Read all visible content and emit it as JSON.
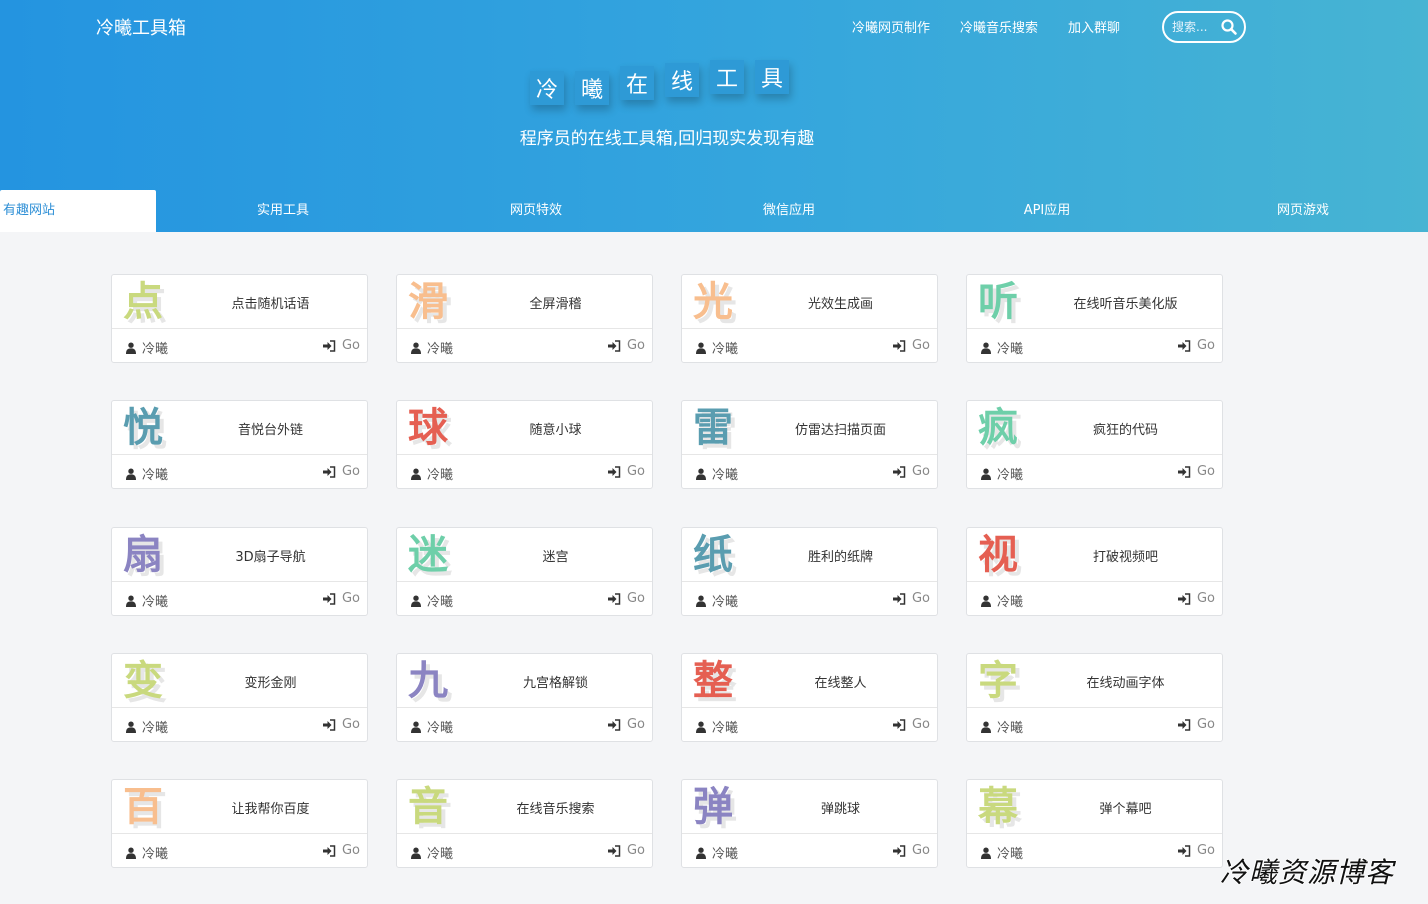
{
  "brand": "冷曦工具箱",
  "topnav": [
    {
      "label": "冷曦网页制作"
    },
    {
      "label": "冷曦音乐搜索"
    },
    {
      "label": "加入群聊"
    }
  ],
  "search": {
    "placeholder": "搜索..."
  },
  "logo_chars": [
    "冷",
    "曦",
    "在",
    "线",
    "工",
    "具"
  ],
  "subtitle": "程序员的在线工具箱,回归现实发现有趣",
  "tabs": [
    {
      "label": "有趣网站",
      "active": true
    },
    {
      "label": "实用工具"
    },
    {
      "label": "网页特效"
    },
    {
      "label": "微信应用"
    },
    {
      "label": "API应用"
    },
    {
      "label": "网页游戏"
    }
  ],
  "cards": [
    {
      "char": "点",
      "title": "点击随机话语",
      "author": "冷曦",
      "go": "Go",
      "color": "#c9d97e"
    },
    {
      "char": "滑",
      "title": "全屏滑稽",
      "author": "冷曦",
      "go": "Go",
      "color": "#f8be8e"
    },
    {
      "char": "光",
      "title": "光效生成画",
      "author": "冷曦",
      "go": "Go",
      "color": "#f8be8e"
    },
    {
      "char": "听",
      "title": "在线听音乐美化版",
      "author": "冷曦",
      "go": "Go",
      "color": "#6ecfa9"
    },
    {
      "char": "悦",
      "title": "音悦台外链",
      "author": "冷曦",
      "go": "Go",
      "color": "#5a9db0"
    },
    {
      "char": "球",
      "title": "随意小球",
      "author": "冷曦",
      "go": "Go",
      "color": "#e55f52"
    },
    {
      "char": "雷",
      "title": "仿雷达扫描页面",
      "author": "冷曦",
      "go": "Go",
      "color": "#5a9db0"
    },
    {
      "char": "疯",
      "title": "疯狂的代码",
      "author": "冷曦",
      "go": "Go",
      "color": "#6ecfa9"
    },
    {
      "char": "扇",
      "title": "3D扇子导航",
      "author": "冷曦",
      "go": "Go",
      "color": "#8b84c2"
    },
    {
      "char": "迷",
      "title": "迷宫",
      "author": "冷曦",
      "go": "Go",
      "color": "#6ecfa9"
    },
    {
      "char": "纸",
      "title": "胜利的纸牌",
      "author": "冷曦",
      "go": "Go",
      "color": "#5a9db0"
    },
    {
      "char": "视",
      "title": "打破视频吧",
      "author": "冷曦",
      "go": "Go",
      "color": "#e55f52"
    },
    {
      "char": "变",
      "title": "变形金刚",
      "author": "冷曦",
      "go": "Go",
      "color": "#c9d97e"
    },
    {
      "char": "九",
      "title": "九宫格解锁",
      "author": "冷曦",
      "go": "Go",
      "color": "#8b84c2"
    },
    {
      "char": "整",
      "title": "在线整人",
      "author": "冷曦",
      "go": "Go",
      "color": "#e55f52"
    },
    {
      "char": "字",
      "title": "在线动画字体",
      "author": "冷曦",
      "go": "Go",
      "color": "#c9d97e"
    },
    {
      "char": "百",
      "title": "让我帮你百度",
      "author": "冷曦",
      "go": "Go",
      "color": "#f8be8e"
    },
    {
      "char": "音",
      "title": "在线音乐搜索",
      "author": "冷曦",
      "go": "Go",
      "color": "#c9d97e"
    },
    {
      "char": "弹",
      "title": "弹跳球",
      "author": "冷曦",
      "go": "Go",
      "color": "#8b84c2"
    },
    {
      "char": "幕",
      "title": "弹个幕吧",
      "author": "冷曦",
      "go": "Go",
      "color": "#c9d97e"
    }
  ],
  "watermark": "冷曦资源博客",
  "colors": {
    "accent": "#2e8fd6",
    "header_start": "#2494e0",
    "header_end": "#47b4d3",
    "background": "#f4f5f7"
  },
  "icons": {
    "card_author": "user-icon",
    "card_go": "sign-in-icon",
    "search": "search-icon"
  }
}
